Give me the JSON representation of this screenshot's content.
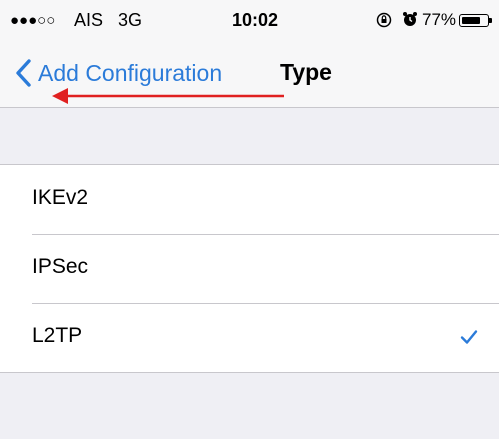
{
  "status_bar": {
    "signal": "●●●○○",
    "carrier": "AIS",
    "network": "3G",
    "time": "10:02",
    "battery_percent": "77%",
    "battery_level": 0.77,
    "icons": [
      "orientation-lock-icon",
      "alarm-icon",
      "battery-icon"
    ]
  },
  "nav": {
    "back_label": "Add Configuration",
    "title": "Type",
    "tint_color": "#2b7bd9"
  },
  "annotation": {
    "arrow_color": "#e02020"
  },
  "types": {
    "items": [
      {
        "label": "IKEv2",
        "selected": false
      },
      {
        "label": "IPSec",
        "selected": false
      },
      {
        "label": "L2TP",
        "selected": true
      }
    ]
  }
}
